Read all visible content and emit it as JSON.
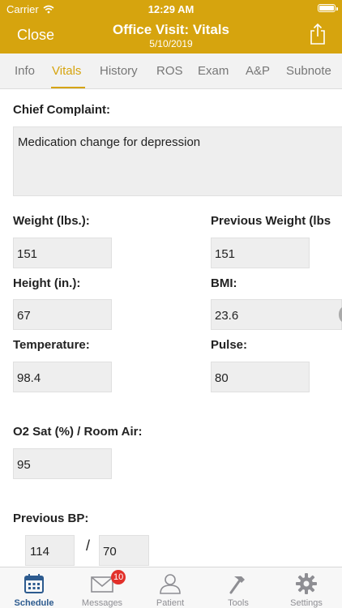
{
  "status_bar": {
    "carrier": "Carrier",
    "time": "12:29 AM"
  },
  "nav": {
    "close_label": "Close",
    "title": "Office Visit: Vitals",
    "subtitle": "5/10/2019"
  },
  "tabs": [
    {
      "label": "Info"
    },
    {
      "label": "Vitals"
    },
    {
      "label": "History"
    },
    {
      "label": "ROS"
    },
    {
      "label": "Exam"
    },
    {
      "label": "A&P"
    },
    {
      "label": "Subnote"
    }
  ],
  "active_tab": "Vitals",
  "form": {
    "chief_complaint": {
      "label": "Chief Complaint:",
      "value": "Medication change for depression"
    },
    "weight": {
      "label": "Weight (lbs.):",
      "value": "151"
    },
    "previous_weight": {
      "label": "Previous Weight (lbs",
      "value": "151"
    },
    "height": {
      "label": "Height (in.):",
      "value": "67"
    },
    "bmi": {
      "label": "BMI:",
      "value": "23.6"
    },
    "temperature": {
      "label": "Temperature:",
      "value": "98.4"
    },
    "pulse": {
      "label": "Pulse:",
      "value": "80"
    },
    "o2_sat": {
      "label": "O2 Sat (%) / Room Air:",
      "value": "95"
    },
    "previous_bp": {
      "label": "Previous BP:",
      "systolic": "114",
      "separator": "/",
      "diastolic": "70"
    }
  },
  "tabbar": {
    "items": [
      {
        "label": "Schedule",
        "icon": "calendar-icon"
      },
      {
        "label": "Messages",
        "icon": "envelope-icon",
        "badge": "10"
      },
      {
        "label": "Patient",
        "icon": "person-icon"
      },
      {
        "label": "Tools",
        "icon": "hammer-icon"
      },
      {
        "label": "Settings",
        "icon": "gear-icon"
      }
    ],
    "active": "Schedule"
  },
  "colors": {
    "brand": "#d6a40e",
    "required_marker": "#e6552b",
    "active_tabbar": "#2d5b8f",
    "badge": "#e2302a"
  }
}
